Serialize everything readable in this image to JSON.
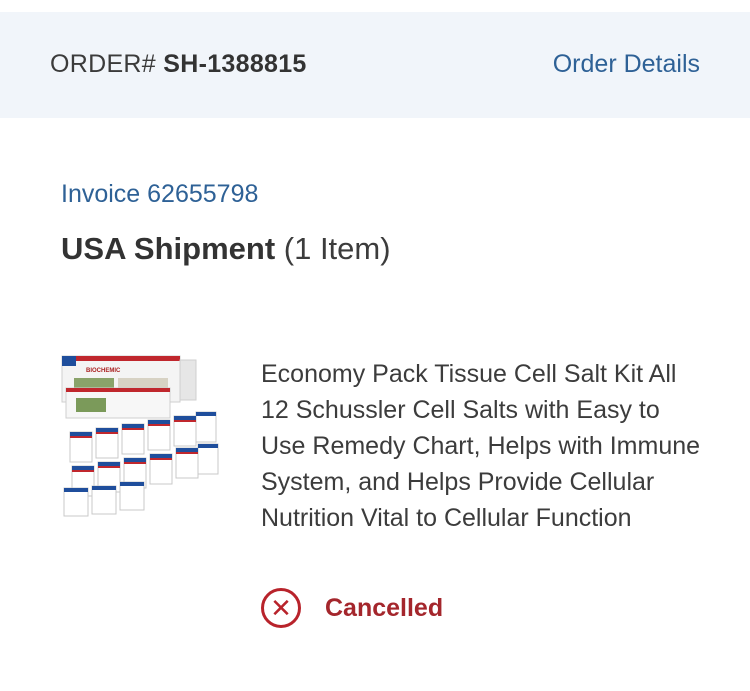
{
  "order": {
    "label": "ORDER#",
    "number": "SH-1388815",
    "details_link": "Order Details"
  },
  "invoice": {
    "text": "Invoice 62655798"
  },
  "shipment": {
    "title": "USA Shipment",
    "count": "(1 Item)"
  },
  "product": {
    "image_icon": "product-box-image",
    "box_label": "BIOCHEMIC",
    "description": "Economy Pack Tissue Cell Salt Kit All 12 Schussler Cell Salts with Easy to Use Remedy Chart, Helps with Immune System, and Helps Provide Cellular Nutrition Vital to Cellular Function"
  },
  "status": {
    "icon": "x-circle-icon",
    "text": "Cancelled",
    "color": "#a4262c"
  },
  "colors": {
    "link": "#2e6196",
    "header_bg": "#f1f5fa"
  }
}
